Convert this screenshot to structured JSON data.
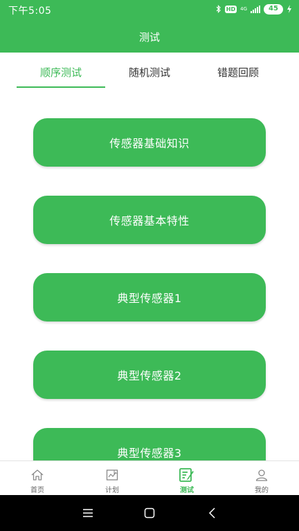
{
  "status_bar": {
    "time": "下午5:05",
    "hd": "HD",
    "network": "4G",
    "battery": "45"
  },
  "header": {
    "title": "测试"
  },
  "tabs": [
    {
      "label": "顺序测试"
    },
    {
      "label": "随机测试"
    },
    {
      "label": "错题回顾"
    }
  ],
  "tests": [
    {
      "label": "传感器基础知识"
    },
    {
      "label": "传感器基本特性"
    },
    {
      "label": "典型传感器1"
    },
    {
      "label": "典型传感器2"
    },
    {
      "label": "典型传感器3"
    }
  ],
  "bottom_nav": [
    {
      "label": "首页",
      "icon": "home-icon"
    },
    {
      "label": "计划",
      "icon": "plan-icon"
    },
    {
      "label": "测试",
      "icon": "test-icon"
    },
    {
      "label": "我的",
      "icon": "profile-icon"
    }
  ],
  "colors": {
    "accent": "#3dba57",
    "text": "#333333",
    "nav_text": "#666666",
    "system_bar": "#000000"
  }
}
